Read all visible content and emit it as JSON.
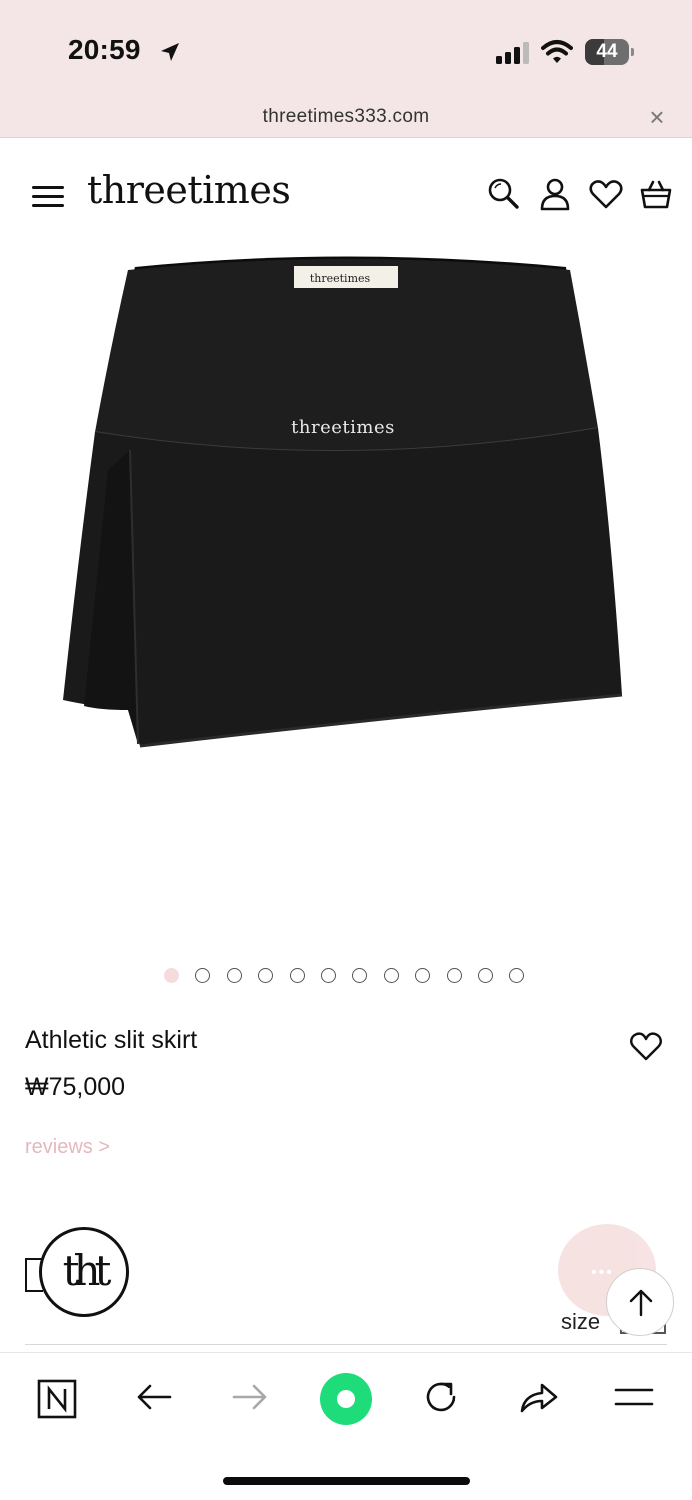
{
  "status_bar": {
    "time": "20:59",
    "battery": "44",
    "battery_level": 0.44
  },
  "url_bar": {
    "domain": "threetimes333.com",
    "close_label": "×"
  },
  "header": {
    "logo": "threetimes"
  },
  "product_image": {
    "waistband_logo": "threetimes",
    "label_tag": "threetimes",
    "alt_icon": "skirt-image"
  },
  "carousel": {
    "count": 12,
    "active_index": 0
  },
  "product": {
    "name": "Athletic slit skirt",
    "price": "₩75,000",
    "reviews_link": "reviews >"
  },
  "floating": {
    "badge_text": "tht",
    "size_label": "size",
    "chat_dots": "•••"
  },
  "colors": {
    "topbar_bg": "#f4e6e6",
    "reviews": "#e3b8be",
    "dot_active": "#f4dcdc",
    "nav_green": "#1fdc7b"
  },
  "icons": {
    "header": [
      "menu-icon",
      "search-icon",
      "user-icon",
      "heart-icon",
      "cart-icon"
    ],
    "toolbar": [
      "naver-icon",
      "back-icon",
      "forward-icon",
      "home-icon",
      "reload-icon",
      "share-icon",
      "more-icon"
    ]
  }
}
